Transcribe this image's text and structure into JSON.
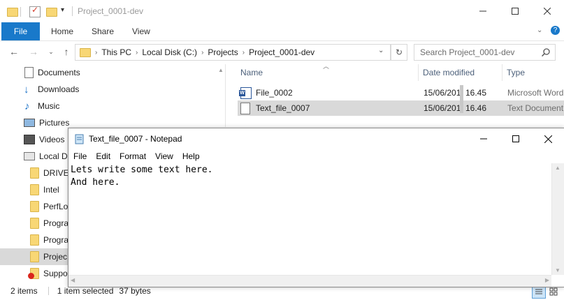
{
  "explorer": {
    "title": "Project_0001-dev",
    "ribbon_tabs": [
      "File",
      "Home",
      "Share",
      "View"
    ],
    "breadcrumbs": [
      "This PC",
      "Local Disk (C:)",
      "Projects",
      "Project_0001-dev"
    ],
    "search_placeholder": "Search Project_0001-dev",
    "nav_tree": [
      {
        "label": "Documents",
        "icon": "documents-icon"
      },
      {
        "label": "Downloads",
        "icon": "downloads-icon"
      },
      {
        "label": "Music",
        "icon": "music-icon"
      },
      {
        "label": "Pictures",
        "icon": "pictures-icon"
      },
      {
        "label": "Videos",
        "icon": "videos-icon"
      },
      {
        "label": "Local Di",
        "icon": "drive-icon"
      },
      {
        "label": "DRIVEI",
        "icon": "folder-icon"
      },
      {
        "label": "Intel",
        "icon": "folder-icon"
      },
      {
        "label": "PerfLo",
        "icon": "folder-icon"
      },
      {
        "label": "Progra",
        "icon": "folder-icon"
      },
      {
        "label": "Progra",
        "icon": "folder-icon"
      },
      {
        "label": "Projec",
        "icon": "folder-icon"
      },
      {
        "label": "Suppo",
        "icon": "folder-error-icon"
      }
    ],
    "columns": {
      "name": "Name",
      "date": "Date modified",
      "type": "Type"
    },
    "files": [
      {
        "name": "File_0002",
        "date": "15/06/201",
        "time": "16.45",
        "type": "Microsoft Word",
        "icon": "word-doc-icon"
      },
      {
        "name": "Text_file_0007",
        "date": "15/06/201",
        "time": "16.46",
        "type": "Text Document",
        "icon": "text-doc-icon"
      }
    ],
    "status": {
      "items": "2 items",
      "selected": "1 item selected",
      "size": "37 bytes"
    }
  },
  "notepad": {
    "title": "Text_file_0007 - Notepad",
    "menu": [
      "File",
      "Edit",
      "Format",
      "View",
      "Help"
    ],
    "content": "Lets write some text here.\nAnd here."
  },
  "colors": {
    "accent": "#1979ca",
    "selection": "#d9d9d9"
  }
}
